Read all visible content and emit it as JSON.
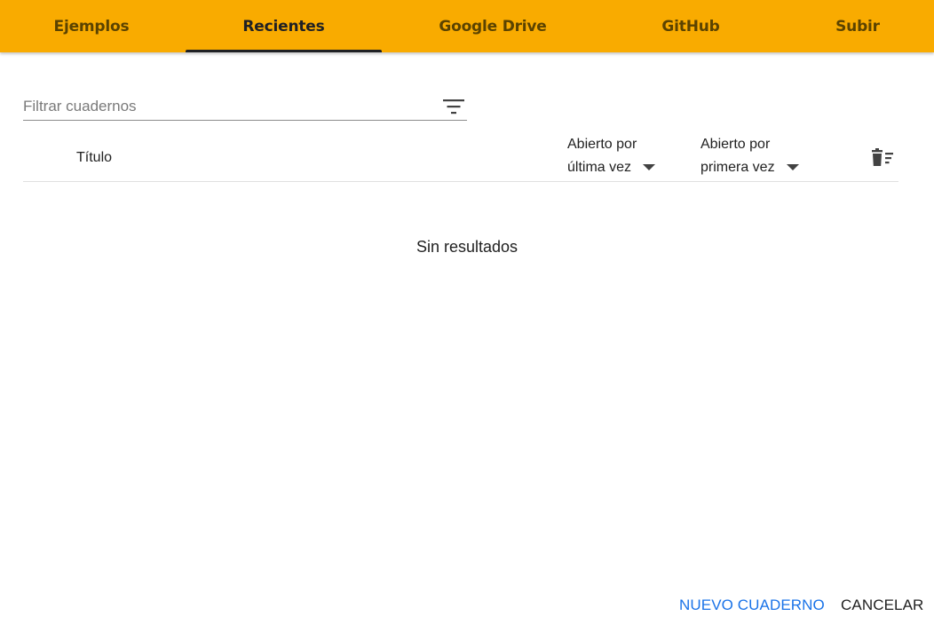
{
  "tabs": [
    {
      "label": "Ejemplos",
      "active": false
    },
    {
      "label": "Recientes",
      "active": true
    },
    {
      "label": "Google Drive",
      "active": false
    },
    {
      "label": "GitHub",
      "active": false
    },
    {
      "label": "Subir",
      "active": false
    }
  ],
  "filter": {
    "placeholder": "Filtrar cuadernos",
    "value": "",
    "icon": "filter-list-icon"
  },
  "table": {
    "columns": {
      "title": "Título",
      "last_opened": {
        "line1": "Abierto por",
        "line2": "última vez"
      },
      "first_opened": {
        "line1": "Abierto por",
        "line2": "primera vez"
      }
    },
    "trash_icon": "delete-sweep-icon",
    "empty_message": "Sin resultados"
  },
  "actions": {
    "new_notebook": "NUEVO CUADERNO",
    "cancel": "CANCELAR"
  },
  "colors": {
    "tabbar_bg": "#f9ab00",
    "primary_button": "#1a73e8",
    "active_indicator": "#202124"
  }
}
